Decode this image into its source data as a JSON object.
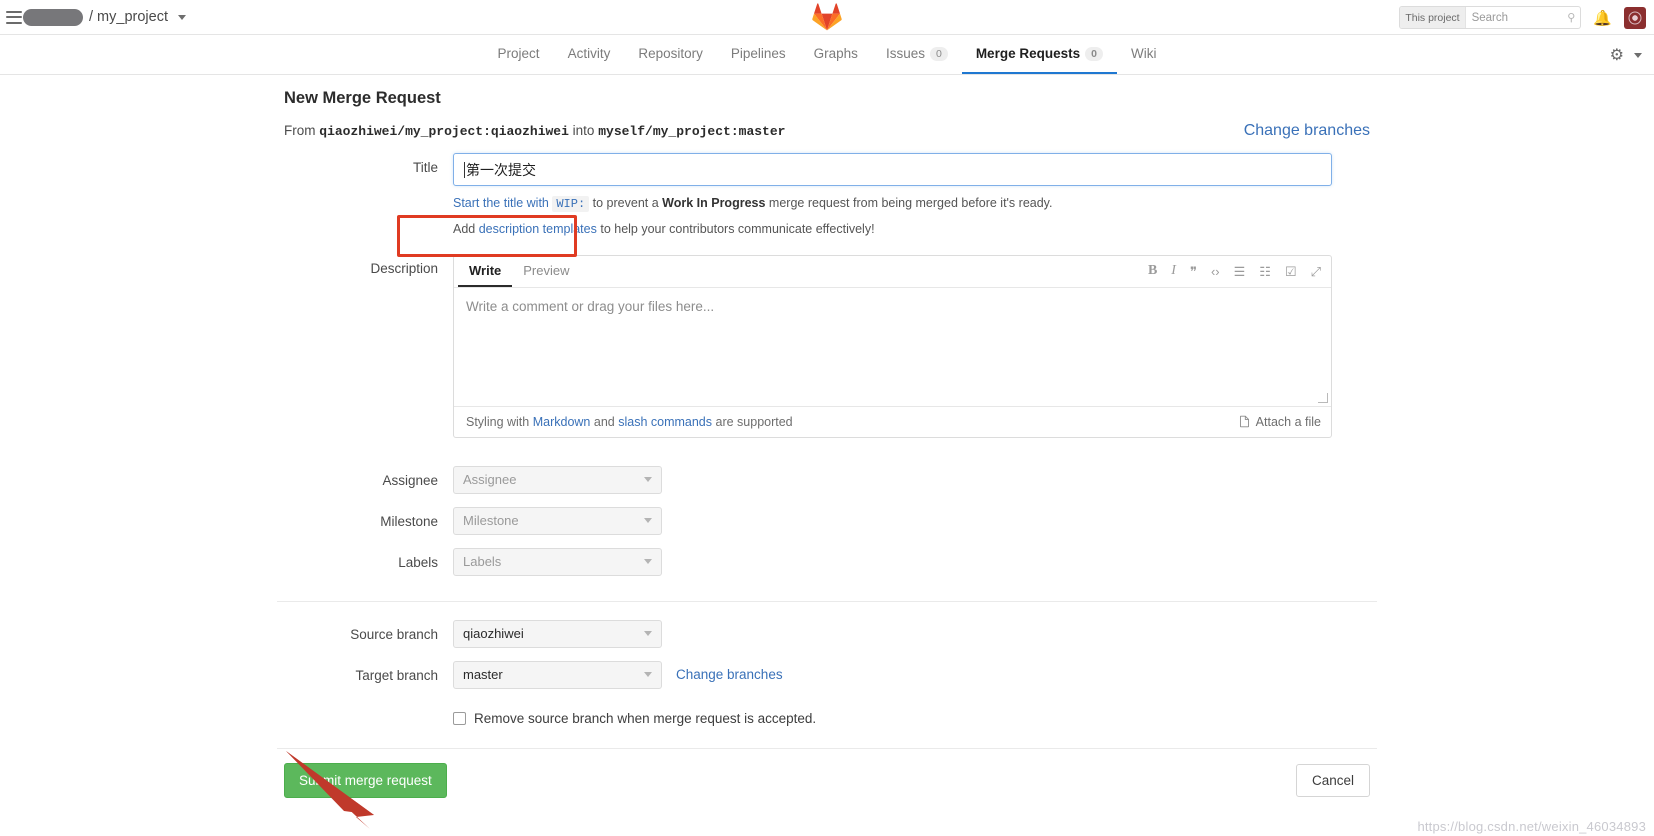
{
  "topbar": {
    "project_path": "/ my_project",
    "search_scope": "This project",
    "search_placeholder": "Search",
    "search_value": "",
    "icons": {
      "hamburger": "hamburger-icon",
      "logo": "gitlab-logo",
      "bell": "bell-icon",
      "avatar": "user-avatar"
    }
  },
  "nav": {
    "items": [
      {
        "label": "Project",
        "count": null,
        "active": false
      },
      {
        "label": "Activity",
        "count": null,
        "active": false
      },
      {
        "label": "Repository",
        "count": null,
        "active": false
      },
      {
        "label": "Pipelines",
        "count": null,
        "active": false
      },
      {
        "label": "Graphs",
        "count": null,
        "active": false
      },
      {
        "label": "Issues",
        "count": "0",
        "active": false
      },
      {
        "label": "Merge Requests",
        "count": "0",
        "active": true
      },
      {
        "label": "Wiki",
        "count": null,
        "active": false
      }
    ]
  },
  "page": {
    "title": "New Merge Request",
    "from_prefix": "From",
    "source_ref": "qiaozhiwei/my_project:qiaozhiwei",
    "into_word": "into",
    "target_ref": "myself/my_project:master",
    "change_branches_top": "Change branches"
  },
  "title_field": {
    "label": "Title",
    "value": "第一次提交",
    "placeholder": "",
    "hint_lead": "Start the title with",
    "hint_code": "WIP:",
    "hint_mid": "to prevent a",
    "hint_bold": "Work In Progress",
    "hint_tail": "merge request from being merged before it's ready.",
    "templates_lead": "Add",
    "templates_link": "description templates",
    "templates_tail": "to help your contributors communicate effectively!"
  },
  "description": {
    "label": "Description",
    "tabs": [
      {
        "label": "Write",
        "active": true
      },
      {
        "label": "Preview",
        "active": false
      }
    ],
    "toolbar": [
      {
        "glyph": "B",
        "name": "bold-icon"
      },
      {
        "glyph": "I",
        "name": "italic-icon"
      },
      {
        "glyph": "❞",
        "name": "quote-icon"
      },
      {
        "glyph": "‹›",
        "name": "code-icon"
      },
      {
        "glyph": "☰",
        "name": "bullet-list-icon"
      },
      {
        "glyph": "☷",
        "name": "numbered-list-icon"
      },
      {
        "glyph": "☑",
        "name": "task-list-icon"
      },
      {
        "glyph": "⤢",
        "name": "fullscreen-icon"
      }
    ],
    "placeholder": "Write a comment or drag your files here...",
    "value": "",
    "foot_lead": "Styling with",
    "foot_markdown": "Markdown",
    "foot_and": "and",
    "foot_slash": "slash commands",
    "foot_tail": "are supported",
    "attach_label": "Attach a file"
  },
  "fields": {
    "assignee": {
      "label": "Assignee",
      "value": "",
      "placeholder": "Assignee"
    },
    "milestone": {
      "label": "Milestone",
      "value": "",
      "placeholder": "Milestone"
    },
    "labels": {
      "label": "Labels",
      "value": "",
      "placeholder": "Labels"
    },
    "source_branch": {
      "label": "Source branch",
      "value": "qiaozhiwei",
      "placeholder": ""
    },
    "target_branch": {
      "label": "Target branch",
      "value": "master",
      "placeholder": ""
    },
    "change_branches_link": "Change branches",
    "remove_source_branch": "Remove source branch when merge request is accepted.",
    "remove_source_branch_checked": false
  },
  "actions": {
    "submit": "Submit merge request",
    "cancel": "Cancel"
  },
  "watermark": "https://blog.csdn.net/weixin_46034893",
  "colors": {
    "accent_blue": "#3a71b8",
    "active_tab_underline": "#1f78d1",
    "submit_green": "#5cb85c",
    "annotation_red": "#e03b22",
    "input_focus_border": "#80b0e8"
  }
}
